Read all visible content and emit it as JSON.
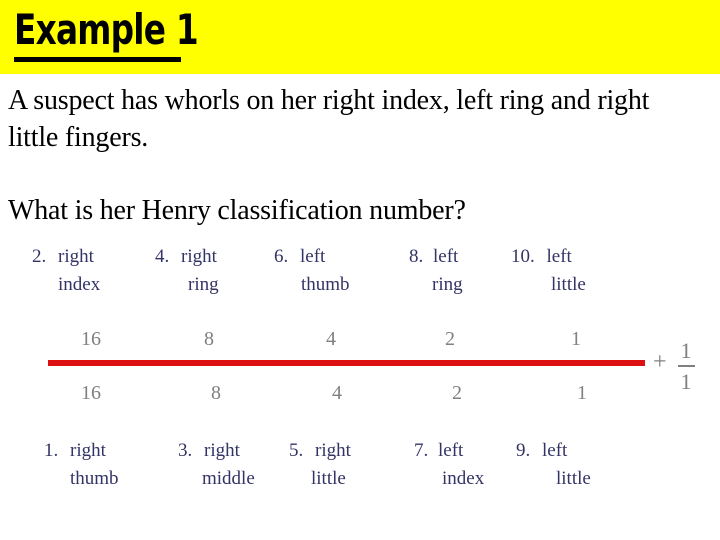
{
  "slide": {
    "title": "Example 1",
    "background_color": "#ffffff",
    "title_band_color": "#ffff00",
    "title_color": "#000000",
    "label_color": "#333366",
    "value_color": "#808080",
    "rule_color": "#dd1111"
  },
  "body": {
    "paragraph_1": "A suspect has whorls on her right index, left ring and right little fingers.",
    "paragraph_2": "What is her Henry classification number?"
  },
  "henry_table": {
    "numerator_labels": [
      {
        "number": "2.",
        "word1": "right",
        "word2": "index"
      },
      {
        "number": "4.",
        "word1": "right",
        "word2": "ring"
      },
      {
        "number": "6.",
        "word1": "left",
        "word2": "thumb"
      },
      {
        "number": "8.",
        "word1": "left",
        "word2": "ring"
      },
      {
        "number": "10.",
        "word1": "left",
        "word2": "little"
      }
    ],
    "numerator_values": [
      "16",
      "8",
      "4",
      "2",
      "1"
    ],
    "denominator_values": [
      "16",
      "8",
      "4",
      "2",
      "1"
    ],
    "denominator_labels": [
      {
        "number": "1.",
        "word1": "right",
        "word2": "thumb"
      },
      {
        "number": "3.",
        "word1": "right",
        "word2": "middle"
      },
      {
        "number": "5.",
        "word1": "right",
        "word2": "little"
      },
      {
        "number": "7.",
        "word1": "left",
        "word2": "index"
      },
      {
        "number": "9.",
        "word1": "left",
        "word2": "little"
      }
    ],
    "plus_sign": "+",
    "extra_fraction": {
      "numerator": "1",
      "denominator": "1"
    }
  }
}
